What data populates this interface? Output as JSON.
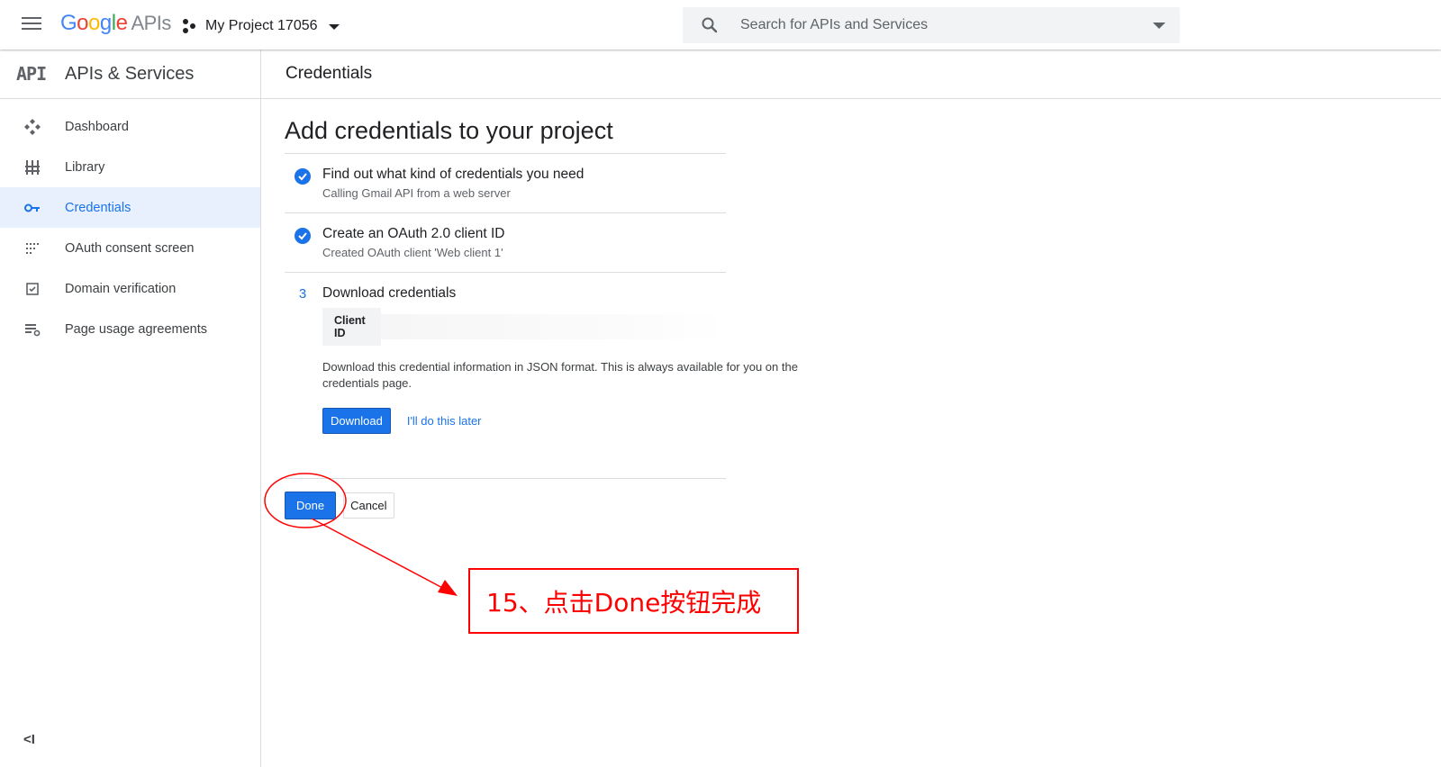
{
  "header": {
    "logo_letters": [
      "G",
      "o",
      "o",
      "g",
      "l",
      "e"
    ],
    "logo_suffix": "APIs",
    "project_name": "My Project 17056",
    "search_placeholder": "Search for APIs and Services"
  },
  "sidebar": {
    "badge": "API",
    "title": "APIs & Services",
    "items": [
      {
        "label": "Dashboard",
        "icon": "dashboard-icon"
      },
      {
        "label": "Library",
        "icon": "library-icon"
      },
      {
        "label": "Credentials",
        "icon": "key-icon",
        "active": true
      },
      {
        "label": "OAuth consent screen",
        "icon": "consent-screen-icon"
      },
      {
        "label": "Domain verification",
        "icon": "checkbox-icon"
      },
      {
        "label": "Page usage agreements",
        "icon": "settings-list-icon"
      }
    ],
    "collapse_label": "<I"
  },
  "main": {
    "page_title": "Credentials",
    "heading": "Add credentials to your project",
    "steps": [
      {
        "title": "Find out what kind of credentials you need",
        "subtitle": "Calling Gmail API from a web server",
        "status": "complete"
      },
      {
        "title": "Create an OAuth 2.0 client ID",
        "subtitle": "Created OAuth client 'Web client 1'",
        "status": "complete"
      },
      {
        "number": "3",
        "title": "Download credentials",
        "status": "current"
      }
    ],
    "client_id_label": "Client ID",
    "description": "Download this credential information in JSON format. This is always available for you on the credentials page.",
    "download_label": "Download",
    "later_label": "I'll do this later",
    "done_label": "Done",
    "cancel_label": "Cancel"
  },
  "annotation": {
    "text": "15、点击Done按钮完成",
    "color": "#ff0000"
  },
  "colors": {
    "accent": "#1a73e8",
    "active_bg": "#e8f0fe"
  }
}
